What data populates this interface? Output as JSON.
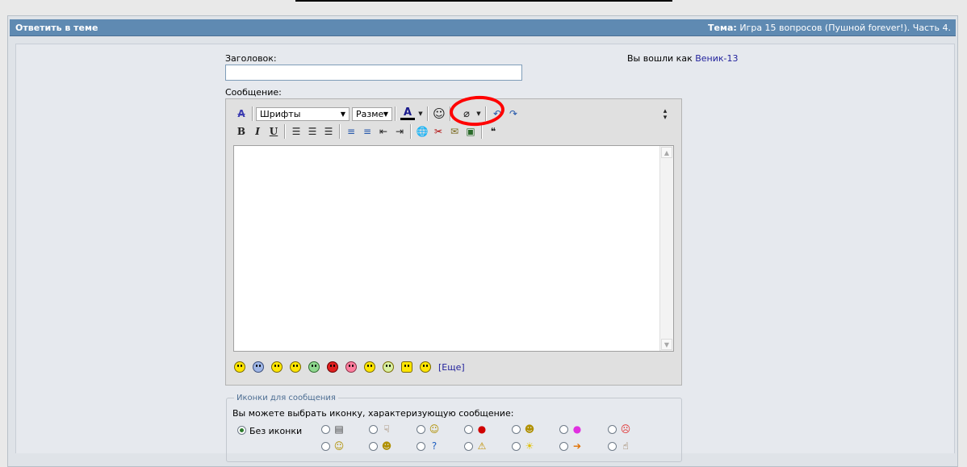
{
  "header": {
    "left": "Ответить в теме",
    "topic_label": "Тема:",
    "topic_value": "Игра 15 вопросов (Пушной forever!). Часть 4."
  },
  "form": {
    "title_label": "Заголовок:",
    "message_label": "Сообщение:",
    "logged_in_prefix": "Вы вошли как",
    "username": "Веник-13"
  },
  "toolbar": {
    "font_select": "Шрифты",
    "size_select": "Разме",
    "more_link": "[Еще]"
  },
  "icons_section": {
    "legend": "Иконки для сообщения",
    "hint": "Вы можете выбрать иконку, характеризующую сообщение:",
    "no_icon": "Без иконки"
  },
  "colors": {
    "header_bg": "#5f8ab2",
    "link": "#22229c",
    "annotation": "#ff0000"
  }
}
